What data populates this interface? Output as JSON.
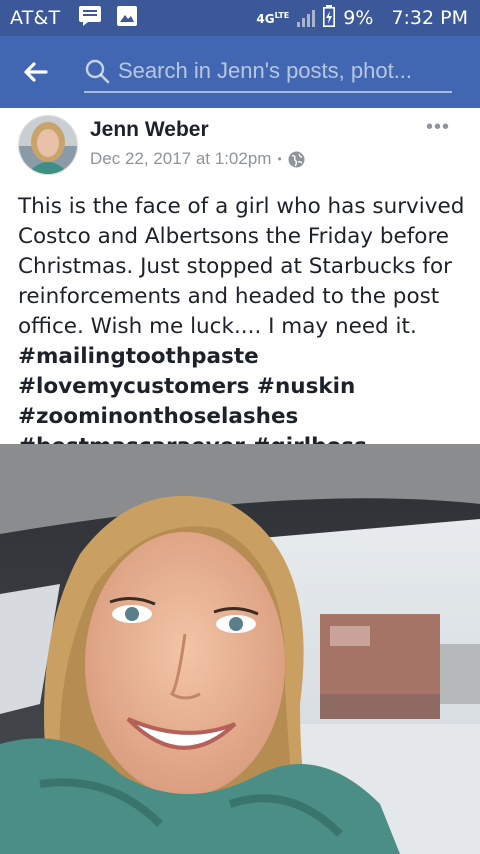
{
  "status_bar": {
    "carrier": "AT&T",
    "network": "4G",
    "network_sub": "LTE",
    "battery": "9%",
    "time": "7:32 PM"
  },
  "search": {
    "placeholder": "Search in Jenn's posts, phot..."
  },
  "post": {
    "author": "Jenn Weber",
    "date": "Dec 22, 2017 at 1:02pm",
    "separator": "•",
    "more": "•••",
    "text": "This is the face of a girl who has survived Costco and Albertsons the Friday before Christmas. Just stopped at Starbucks for reinforcements and headed to the post office. Wish me luck.... I may need it.",
    "hashtags": "#mailingtoothpaste #lovemycustomers #nuskin #zoominonthoselashes #bestmascaraever #girlboss"
  },
  "icons": {
    "back": "arrow-left-icon",
    "search": "search-icon",
    "privacy": "globe-icon",
    "notification1": "message-icon",
    "notification2": "image-icon"
  },
  "colors": {
    "status_bar": "#3b5998",
    "search_bar": "#4267b2",
    "author": "#1d2129",
    "meta": "#8d949e"
  }
}
